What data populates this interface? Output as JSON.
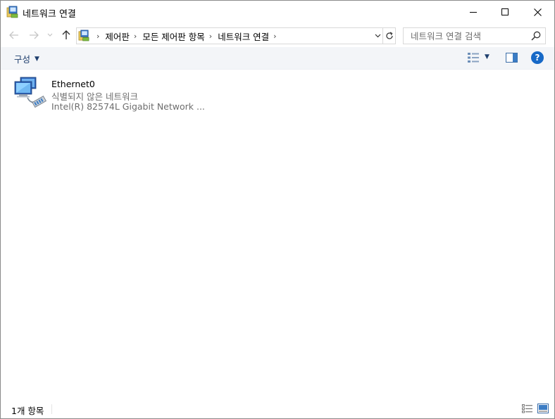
{
  "window": {
    "title": "네트워크 연결",
    "controls": {
      "minimize": "minimize-icon",
      "maximize": "maximize-icon",
      "close": "close-icon"
    }
  },
  "navigation": {
    "breadcrumbs": [
      "제어판",
      "모든 제어판 항목",
      "네트워크 연결"
    ]
  },
  "search": {
    "placeholder": "네트워크 연결 검색"
  },
  "toolbar": {
    "organize_label": "구성",
    "help_label": "?"
  },
  "items": [
    {
      "name": "Ethernet0",
      "status": "식별되지 않은 네트워크",
      "device": "Intel(R) 82574L Gigabit Network ..."
    }
  ],
  "statusbar": {
    "count_text": "1개 항목"
  },
  "colors": {
    "accent": "#1769c7",
    "toolbar_bg": "#f3f5f8",
    "secondary_text": "#6d6d6d"
  }
}
